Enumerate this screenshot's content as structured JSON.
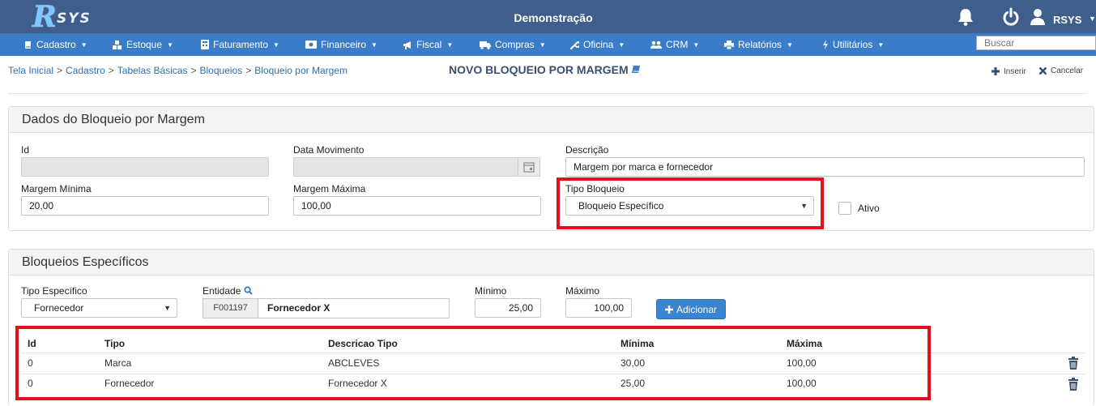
{
  "header": {
    "logo_text": "RSYS",
    "app_title": "Demonstração",
    "user_name": "RSYS"
  },
  "menu": [
    {
      "label": "Cadastro",
      "icon": "book-icon"
    },
    {
      "label": "Estoque",
      "icon": "cubes-icon"
    },
    {
      "label": "Faturamento",
      "icon": "calculator-icon"
    },
    {
      "label": "Financeiro",
      "icon": "money-icon"
    },
    {
      "label": "Fiscal",
      "icon": "bullhorn-icon"
    },
    {
      "label": "Compras",
      "icon": "truck-icon"
    },
    {
      "label": "Oficina",
      "icon": "wrench-icon"
    },
    {
      "label": "CRM",
      "icon": "users-icon"
    },
    {
      "label": "Relatórios",
      "icon": "print-icon"
    },
    {
      "label": "Utilitários",
      "icon": "bolt-icon"
    }
  ],
  "search": {
    "placeholder": "Buscar"
  },
  "breadcrumb": [
    "Tela Inicial",
    "Cadastro",
    "Tabelas Básicas",
    "Bloqueios",
    "Bloqueio por Margem"
  ],
  "page_title": "NOVO BLOQUEIO POR MARGEM",
  "actions": {
    "insert": "Inserir",
    "cancel": "Cancelar"
  },
  "panel_dados": {
    "title": "Dados do Bloqueio por Margem",
    "id_label": "Id",
    "id_value": "",
    "data_mov_label": "Data Movimento",
    "data_mov_value": "",
    "descricao_label": "Descrição",
    "descricao_value": "Margem por marca e fornecedor",
    "margem_min_label": "Margem Mínima",
    "margem_min_value": "20,00",
    "margem_max_label": "Margem Máxima",
    "margem_max_value": "100,00",
    "tipo_bloqueio_label": "Tipo Bloqueio",
    "tipo_bloqueio_value": "Bloqueio Específico",
    "ativo_label": "Ativo",
    "ativo_checked": false
  },
  "panel_especificos": {
    "title": "Bloqueios Específicos",
    "tipo_especifico_label": "Tipo Específico",
    "tipo_especifico_value": "Fornecedor",
    "entidade_label": "Entidade",
    "entidade_code": "F001197",
    "entidade_name": "Fornecedor X",
    "minimo_label": "Mínimo",
    "minimo_value": "25,00",
    "maximo_label": "Máximo",
    "maximo_value": "100,00",
    "add_button": "Adicionar"
  },
  "table": {
    "headers": [
      "Id",
      "Tipo",
      "Descricao Tipo",
      "Mínima",
      "Máxima"
    ],
    "rows": [
      [
        "0",
        "Marca",
        "ABCLEVES",
        "30,00",
        "100,00"
      ],
      [
        "0",
        "Fornecedor",
        "Fornecedor X",
        "25,00",
        "100,00"
      ]
    ]
  },
  "colors": {
    "topbar": "#3f5e8c",
    "menubar": "#3a7cc8",
    "link": "#2f6fb1",
    "highlight": "#e3101d",
    "primary_button": "#3a84d0"
  }
}
